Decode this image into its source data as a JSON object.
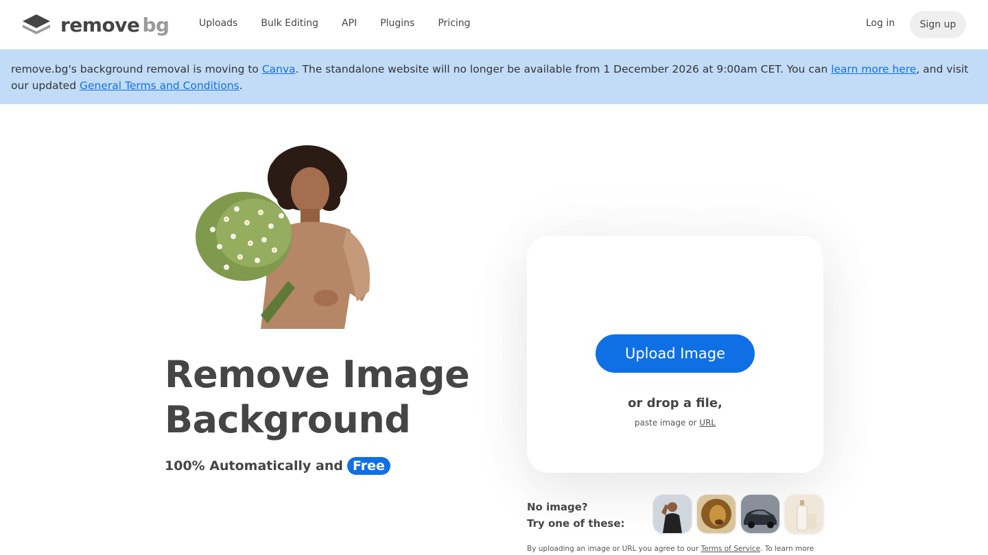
{
  "header": {
    "logo_text": "remove",
    "logo_text_bg": "bg",
    "nav": [
      "Uploads",
      "Bulk Editing",
      "API",
      "Plugins",
      "Pricing"
    ],
    "login_label": "Log in",
    "signup_label": "Sign up"
  },
  "banner": {
    "text1": "remove.bg's background removal is moving to ",
    "link1": "Canva",
    "text2": ". The standalone website will no longer be available from 1 December 2026 at 9:00am CET. You can ",
    "link2": "learn more here",
    "text3": ", and visit our updated ",
    "link3": "General Terms and Conditions",
    "text4": "."
  },
  "hero": {
    "title_line1": "Remove Image",
    "title_line2": "Background",
    "subtitle": "100% Automatically and",
    "badge": "Free"
  },
  "upload": {
    "button_label": "Upload Image",
    "drop_text": "or drop a file,",
    "paste_text": "paste image or ",
    "paste_link": "URL"
  },
  "samples": {
    "line1": "No image?",
    "line2": "Try one of these:",
    "items": [
      "person-sample",
      "lion-sample",
      "car-sample",
      "product-sample"
    ]
  },
  "footer": {
    "tos_text": "By uploading an image or URL you agree to our ",
    "tos_link": "Terms of Service",
    "tos_text2": ". To learn more"
  },
  "colors": {
    "accent": "#0f70e6",
    "banner_bg": "#c2dcf7",
    "text": "#454545"
  }
}
